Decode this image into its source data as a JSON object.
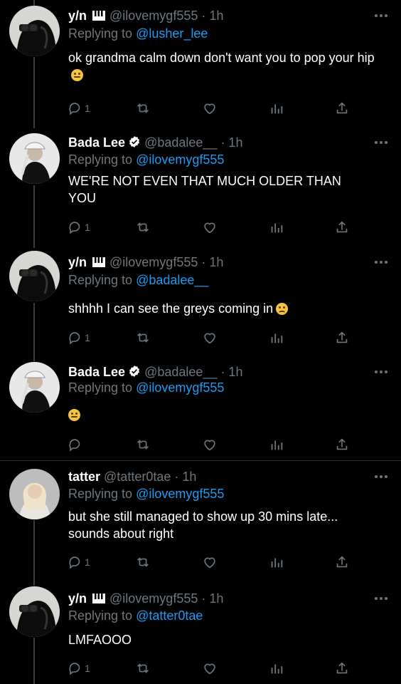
{
  "tweets": [
    {
      "name": "y/n",
      "handle": "@ilovemygf555",
      "time": "· 1h",
      "replying_prefix": "Replying to",
      "replying_to": "@lusher_lee",
      "text": "ok grandma calm down don't want you to pop your hip",
      "emoji": "neutral-face",
      "reply_count": "1",
      "avatar": "black-hoodie-avatar"
    },
    {
      "name": "Bada Lee",
      "handle": "@badalee__",
      "time": "· 1h",
      "replying_prefix": "Replying to",
      "replying_to": "@ilovemygf555",
      "text": "WE'RE NOT EVEN THAT MUCH OLDER THAN YOU",
      "reply_count": "1",
      "avatar": "cap-portrait-avatar"
    },
    {
      "name": "y/n",
      "handle": "@ilovemygf555",
      "time": "· 1h",
      "replying_prefix": "Replying to",
      "replying_to": "@badalee__",
      "text": "shhhh I can see the greys coming in",
      "emoji": "worried-face",
      "reply_count": "1",
      "avatar": "black-hoodie-avatar"
    },
    {
      "name": "Bada Lee",
      "handle": "@badalee__",
      "time": "· 1h",
      "replying_prefix": "Replying to",
      "replying_to": "@ilovemygf555",
      "text": "",
      "emoji": "neutral-face",
      "reply_count": "",
      "avatar": "cap-portrait-avatar"
    },
    {
      "name": "tatter",
      "handle": "@tatter0tae",
      "time": "· 1h",
      "replying_prefix": "Replying to",
      "replying_to": "@ilovemygf555",
      "text": "but she still managed to show up 30 mins late... sounds about right",
      "reply_count": "1",
      "avatar": "blonde-portrait-avatar"
    },
    {
      "name": "y/n",
      "handle": "@ilovemygf555",
      "time": "· 1h",
      "replying_prefix": "Replying to",
      "replying_to": "@tatter0tae",
      "text": "LMFAOOO",
      "reply_count": "1",
      "avatar": "black-hoodie-avatar"
    }
  ],
  "colors": {
    "background": "#000000",
    "muted": "#6e767d",
    "link": "#1d9bf0",
    "verified": "#ffffff"
  }
}
